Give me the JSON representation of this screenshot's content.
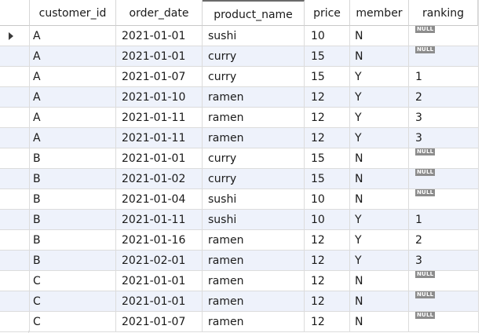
{
  "grid": {
    "columns": [
      "",
      "customer_id",
      "order_date",
      "product_name",
      "price",
      "member",
      "ranking"
    ],
    "sorted_column": "product_name",
    "null_label": "NULL",
    "current_row_indicator": "play-arrow-icon",
    "rows": [
      {
        "customer_id": "A",
        "order_date": "2021-01-01",
        "product_name": "sushi",
        "price": "10",
        "member": "N",
        "ranking": null
      },
      {
        "customer_id": "A",
        "order_date": "2021-01-01",
        "product_name": "curry",
        "price": "15",
        "member": "N",
        "ranking": null
      },
      {
        "customer_id": "A",
        "order_date": "2021-01-07",
        "product_name": "curry",
        "price": "15",
        "member": "Y",
        "ranking": "1"
      },
      {
        "customer_id": "A",
        "order_date": "2021-01-10",
        "product_name": "ramen",
        "price": "12",
        "member": "Y",
        "ranking": "2"
      },
      {
        "customer_id": "A",
        "order_date": "2021-01-11",
        "product_name": "ramen",
        "price": "12",
        "member": "Y",
        "ranking": "3"
      },
      {
        "customer_id": "A",
        "order_date": "2021-01-11",
        "product_name": "ramen",
        "price": "12",
        "member": "Y",
        "ranking": "3"
      },
      {
        "customer_id": "B",
        "order_date": "2021-01-01",
        "product_name": "curry",
        "price": "15",
        "member": "N",
        "ranking": null
      },
      {
        "customer_id": "B",
        "order_date": "2021-01-02",
        "product_name": "curry",
        "price": "15",
        "member": "N",
        "ranking": null
      },
      {
        "customer_id": "B",
        "order_date": "2021-01-04",
        "product_name": "sushi",
        "price": "10",
        "member": "N",
        "ranking": null
      },
      {
        "customer_id": "B",
        "order_date": "2021-01-11",
        "product_name": "sushi",
        "price": "10",
        "member": "Y",
        "ranking": "1"
      },
      {
        "customer_id": "B",
        "order_date": "2021-01-16",
        "product_name": "ramen",
        "price": "12",
        "member": "Y",
        "ranking": "2"
      },
      {
        "customer_id": "B",
        "order_date": "2021-02-01",
        "product_name": "ramen",
        "price": "12",
        "member": "Y",
        "ranking": "3"
      },
      {
        "customer_id": "C",
        "order_date": "2021-01-01",
        "product_name": "ramen",
        "price": "12",
        "member": "N",
        "ranking": null
      },
      {
        "customer_id": "C",
        "order_date": "2021-01-01",
        "product_name": "ramen",
        "price": "12",
        "member": "N",
        "ranking": null
      },
      {
        "customer_id": "C",
        "order_date": "2021-01-07",
        "product_name": "ramen",
        "price": "12",
        "member": "N",
        "ranking": null
      }
    ]
  },
  "colors": {
    "alt_row": "#eef2fb",
    "grid_line": "#dcdcdc",
    "null_badge_bg": "#8c8c8c",
    "null_badge_text": "#ffffff",
    "text": "#1a1a1a"
  }
}
